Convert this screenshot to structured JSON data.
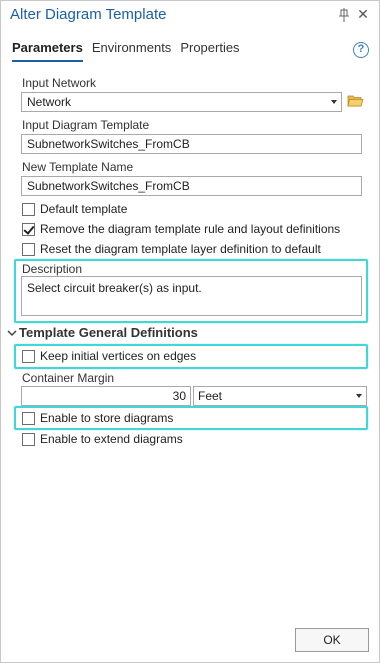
{
  "window": {
    "title": "Alter Diagram Template",
    "close_glyph": "✕"
  },
  "tabs": [
    {
      "label": "Parameters",
      "active": true
    },
    {
      "label": "Environments",
      "active": false
    },
    {
      "label": "Properties",
      "active": false
    }
  ],
  "help_glyph": "?",
  "params": {
    "input_network": {
      "label": "Input Network",
      "value": "Network"
    },
    "input_template": {
      "label": "Input Diagram Template",
      "value": "SubnetworkSwitches_FromCB"
    },
    "new_template": {
      "label": "New Template Name",
      "value": "SubnetworkSwitches_FromCB"
    },
    "default_template": {
      "label": "Default template",
      "checked": false
    },
    "remove_rule": {
      "label": "Remove the diagram template rule and layout definitions",
      "checked": true
    },
    "reset_layer": {
      "label": "Reset the diagram template layer definition to default",
      "checked": false
    },
    "description": {
      "label": "Description",
      "value": "Select circuit breaker(s) as input."
    }
  },
  "section": {
    "title": "Template General Definitions",
    "keep_vertices": {
      "label": "Keep initial vertices on edges",
      "checked": false
    },
    "container_margin": {
      "label": "Container Margin",
      "value": "30",
      "unit": "Feet"
    },
    "enable_store": {
      "label": "Enable to store diagrams",
      "checked": false
    },
    "enable_extend": {
      "label": "Enable to extend diagrams",
      "checked": false
    }
  },
  "footer": {
    "ok_label": "OK"
  },
  "colors": {
    "accent": "#1d5ea8",
    "highlight": "#43d6d6",
    "folder": "#e8b84a"
  }
}
